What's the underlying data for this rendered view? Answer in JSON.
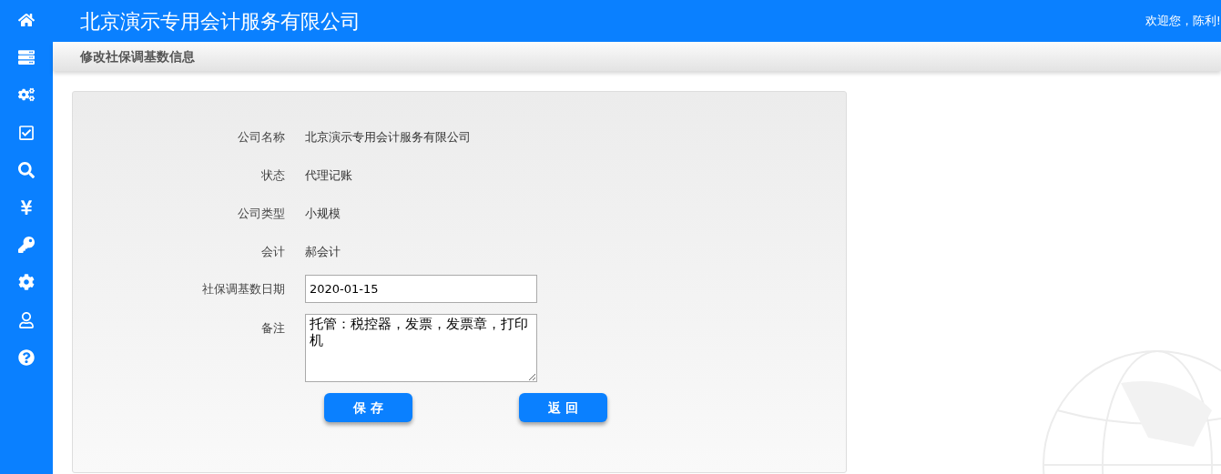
{
  "header": {
    "company": "北京演示专用会计服务有限公司",
    "welcome": "欢迎您，陈利!"
  },
  "sidebar": {
    "items": [
      {
        "kind": "home"
      },
      {
        "kind": "server"
      },
      {
        "kind": "cogs"
      },
      {
        "kind": "check"
      },
      {
        "kind": "search"
      },
      {
        "kind": "yen"
      },
      {
        "kind": "key"
      },
      {
        "kind": "cog"
      },
      {
        "kind": "user"
      },
      {
        "kind": "help"
      }
    ]
  },
  "page_title": "修改社保调基数信息",
  "form": {
    "fields": [
      {
        "kind": "text",
        "label": "公司名称",
        "value": "北京演示专用会计服务有限公司"
      },
      {
        "kind": "text",
        "label": "状态",
        "value": "代理记账"
      },
      {
        "kind": "text",
        "label": "公司类型",
        "value": "小规模"
      },
      {
        "kind": "text",
        "label": "会计",
        "value": "郝会计"
      },
      {
        "kind": "input",
        "label": "社保调基数日期",
        "value": "2020-01-15"
      },
      {
        "kind": "textarea",
        "label": "备注",
        "value": "托管：税控器，发票，发票章，打印机"
      }
    ],
    "buttons": [
      {
        "label": "保 存"
      },
      {
        "label": "返 回"
      }
    ]
  }
}
